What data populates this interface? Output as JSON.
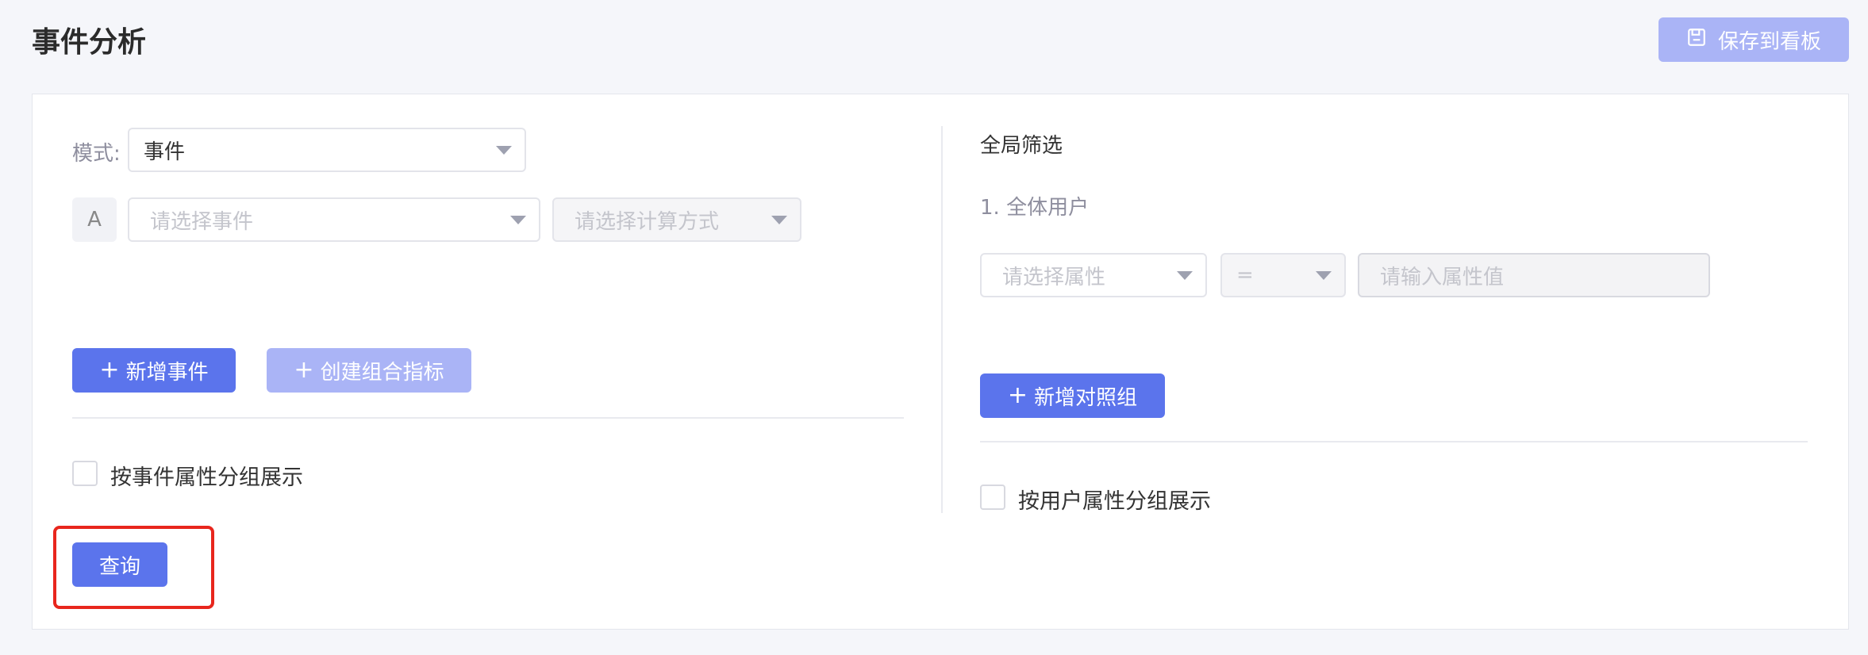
{
  "page": {
    "title": "事件分析",
    "save_label": "保存到看板"
  },
  "left_panel": {
    "mode_label": "模式:",
    "mode_value": "事件",
    "event_badge": "A",
    "event_placeholder": "请选择事件",
    "calc_placeholder": "请选择计算方式",
    "add_event_label": "新增事件",
    "create_combo_label": "创建组合指标",
    "group_by_event_label": "按事件属性分组展示",
    "query_label": "查询"
  },
  "right_panel": {
    "global_filter_title": "全局筛选",
    "filter_item": "1. 全体用户",
    "property_placeholder": "请选择属性",
    "operator_value": "=",
    "value_placeholder": "请输入属性值",
    "add_compare_label": "新增对照组",
    "group_by_user_label": "按用户属性分组展示"
  },
  "colors": {
    "primary": "#5b74ec",
    "primary_disabled": "#aab4f6",
    "highlight": "#e8261d"
  },
  "icons": {
    "save": "save-icon",
    "plus": "plus-icon",
    "caret": "caret-down-icon"
  }
}
